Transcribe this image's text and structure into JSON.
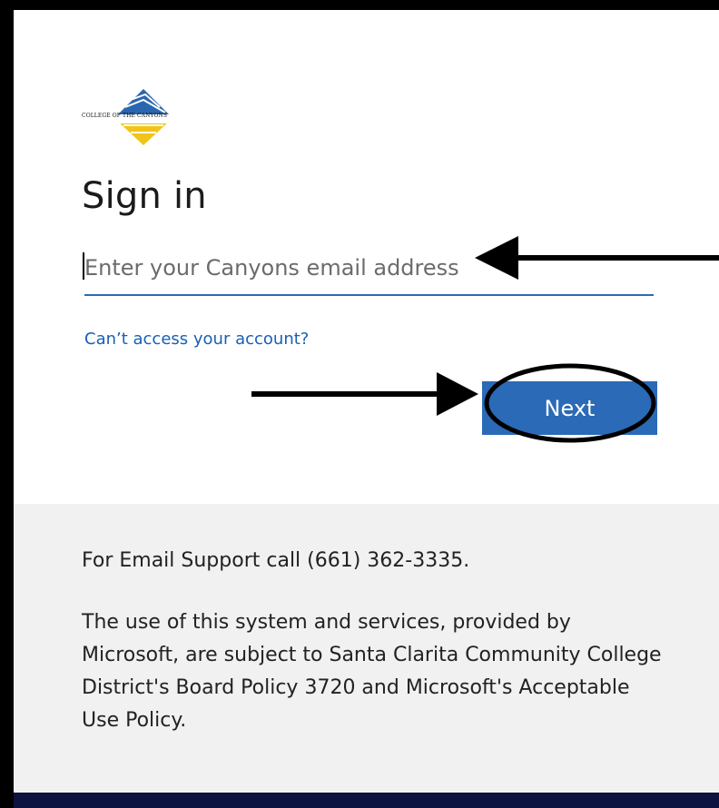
{
  "logo": {
    "text": "COLLEGE OF THE CANYONS"
  },
  "signin": {
    "title": "Sign in",
    "email_placeholder": "Enter your Canyons email address",
    "email_value": "",
    "cant_access_link": "Can’t access your account?",
    "next_label": "Next"
  },
  "footer": {
    "support_text": "For Email Support call (661) 362-3335.",
    "policy_text": "The use of this system and services, provided by Microsoft, are subject to Santa Clarita Community College District's Board Policy 3720 and Microsoft's Acceptable Use Policy."
  },
  "colors": {
    "accent": "#2a6ab7",
    "link": "#1a5fb4",
    "footer_bg": "#f1f1f1",
    "bottom_bar": "#0d1340"
  }
}
